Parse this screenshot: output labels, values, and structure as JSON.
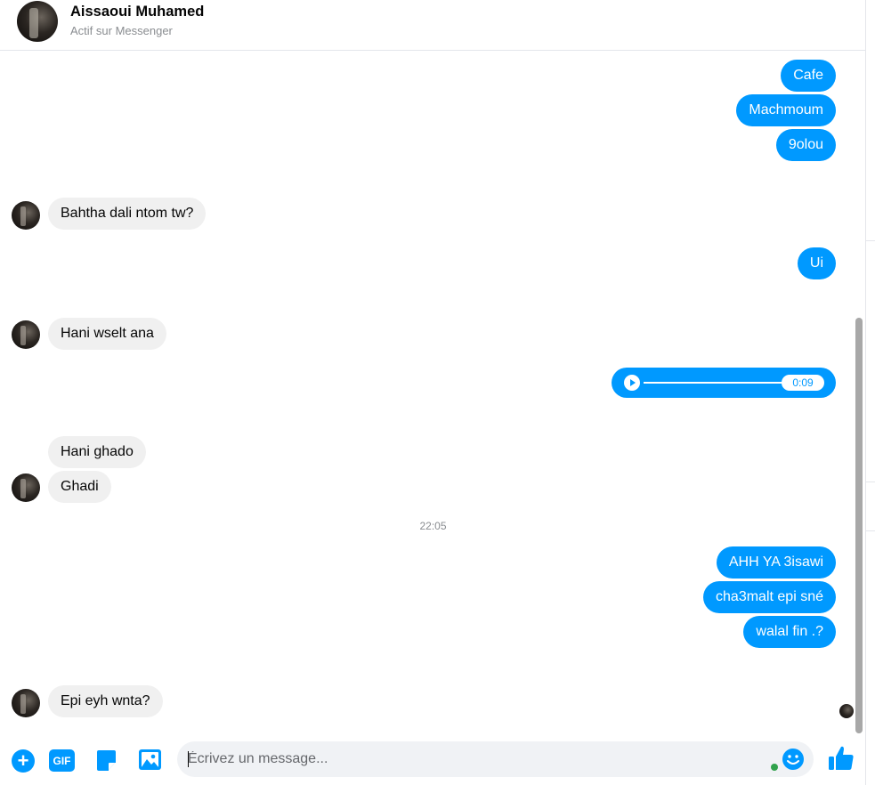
{
  "header": {
    "contact_name": "Aissaoui Muhamed",
    "status": "Actif sur Messenger"
  },
  "messages": {
    "m1": "Cafe",
    "m2": "Machmoum",
    "m3": "9olou",
    "m4": "Bahtha dali ntom tw?",
    "m5": "Ui",
    "m6": "Hani wselt ana",
    "audio_duration": "0:09",
    "m7": "Hani ghado",
    "m8": "Ghadi",
    "timestamp": "22:05",
    "m9": "AHH YA 3isawi",
    "m10": "cha3malt epi sné",
    "m11": "walal fin .?",
    "m12": "Epi eyh wnta?"
  },
  "composer": {
    "placeholder": "Écrivez un message...",
    "gif_label": "GIF",
    "plus_icon": "+"
  },
  "colors": {
    "accent": "#0099ff",
    "incoming_bubble": "#f0f0f0",
    "online": "#31a24c"
  },
  "icons": {
    "add": "plus-icon",
    "gif": "gif-icon",
    "sticker": "sticker-icon",
    "photo": "image-icon",
    "emoji": "emoji-icon",
    "like": "thumbs-up-icon",
    "play": "play-icon"
  }
}
